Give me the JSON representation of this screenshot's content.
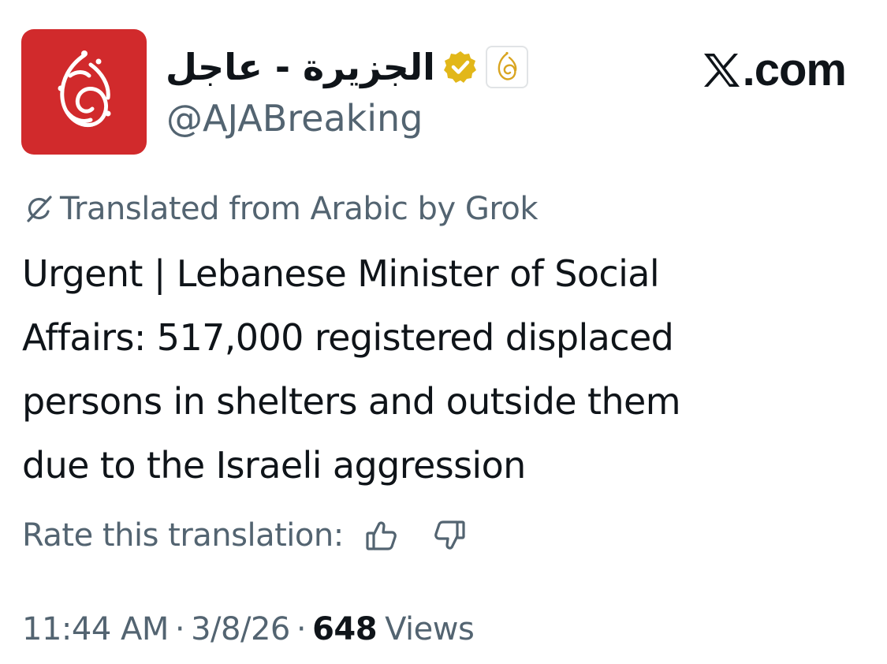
{
  "account": {
    "display_name": "الجزيرة - عاجل",
    "handle": "@AJABreaking",
    "verified": true,
    "affiliate_badge": "aljazeera-logo-icon",
    "avatar_color": "#d12a2c"
  },
  "site": {
    "domain": ".com",
    "logo_icon": "x-logo-icon"
  },
  "translation": {
    "notice": "Translated from Arabic by Grok",
    "icon": "grok-icon"
  },
  "tweet": {
    "lines": [
      "Urgent | Lebanese Minister of Social",
      "Affairs: 517,000 registered displaced",
      "persons in shelters and outside them",
      "due to the Israeli aggression"
    ]
  },
  "rating": {
    "label": "Rate this translation:",
    "thumbs_up_icon": "thumbs-up-icon",
    "thumbs_down_icon": "thumbs-down-icon"
  },
  "meta": {
    "time": "11:44 AM",
    "separator": "·",
    "date": "3/8/26",
    "views_count": "648",
    "views_label": "Views"
  },
  "colors": {
    "text_primary": "#0f1419",
    "text_secondary": "#536471",
    "brand_red": "#d12a2c",
    "verified_gold": "#e2b719"
  }
}
